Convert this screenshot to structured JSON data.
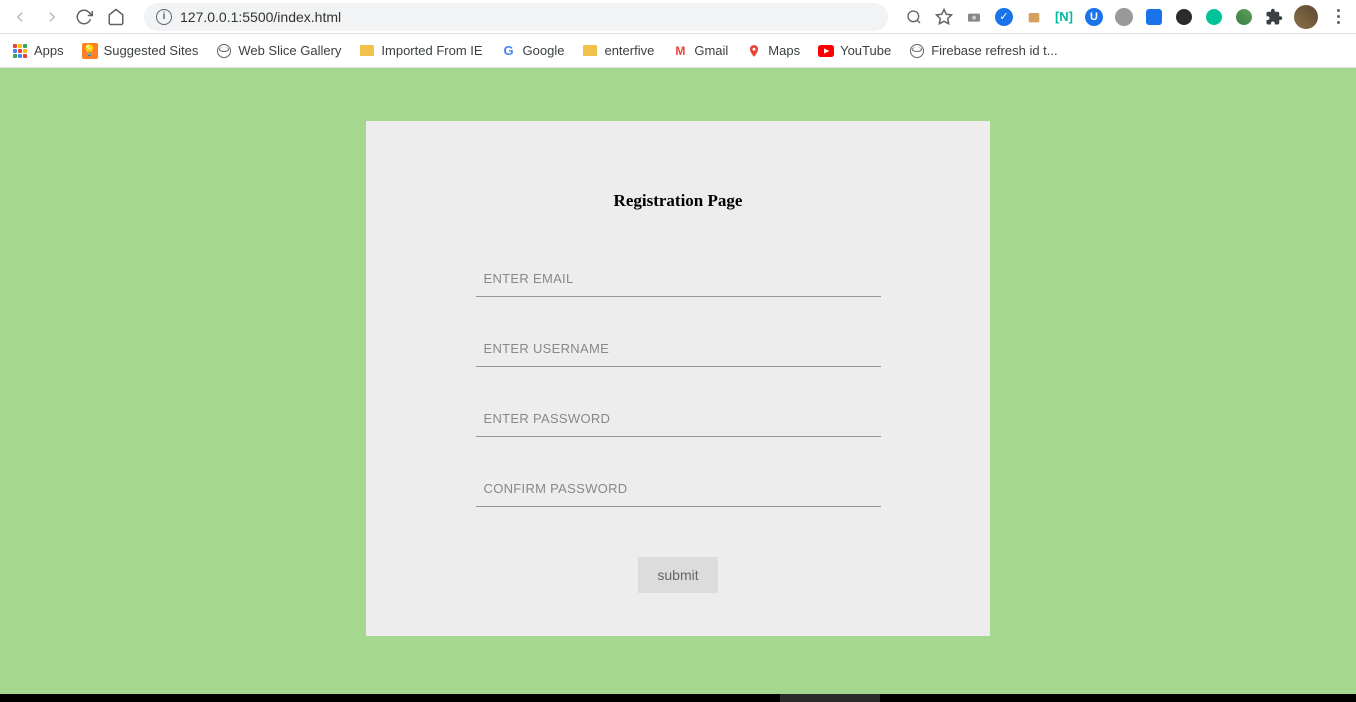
{
  "browser": {
    "url": "127.0.0.1:5500/index.html"
  },
  "bookmarks": {
    "apps": "Apps",
    "suggested": "Suggested Sites",
    "webslice": "Web Slice Gallery",
    "imported": "Imported From IE",
    "google": "Google",
    "enterfive": "enterfive",
    "gmail": "Gmail",
    "maps": "Maps",
    "youtube": "YouTube",
    "firebase": "Firebase refresh id t..."
  },
  "page": {
    "title": "Registration Page",
    "fields": {
      "email_placeholder": "ENTER EMAIL",
      "username_placeholder": "ENTER USERNAME",
      "password_placeholder": "ENTER PASSWORD",
      "confirm_password_placeholder": "CONFIRM PASSWORD"
    },
    "submit_label": "submit"
  }
}
